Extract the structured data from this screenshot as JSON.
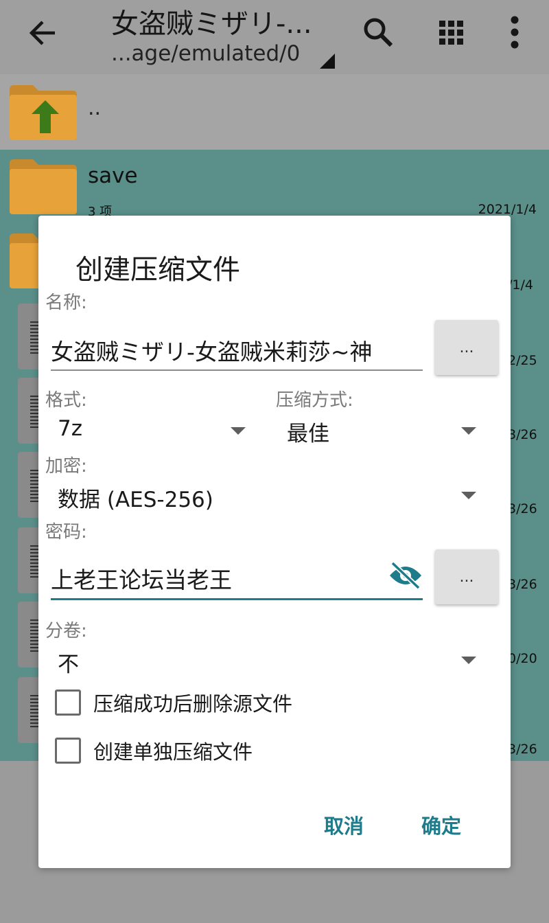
{
  "appbar": {
    "title": "女盗贼ミザリ-...",
    "subtitle": "...age/emulated/0"
  },
  "file_list": {
    "up_label": "..",
    "save_folder": {
      "name": "save",
      "count": "3 项",
      "date": "2021/1/4"
    },
    "date_fragments": [
      "/1/4",
      "2/25",
      "3/26",
      "3/26",
      "3/26",
      "0/20",
      "3/26"
    ]
  },
  "dialog": {
    "title": "创建压缩文件",
    "name_label": "名称:",
    "name_value": "女盗贼ミザリ-女盗贼米莉莎~神",
    "name_browse": "...",
    "format_label": "格式:",
    "format_value": "7z",
    "method_label": "压缩方式:",
    "method_value": "最佳",
    "encrypt_label": "加密:",
    "encrypt_value": "数据 (AES-256)",
    "password_label": "密码:",
    "password_value": "上老王论坛当老王",
    "password_browse": "...",
    "split_label": "分卷:",
    "split_value": "不",
    "delete_source_label": "压缩成功后删除源文件",
    "separate_label": "创建单独压缩文件",
    "cancel_label": "取消",
    "ok_label": "确定"
  },
  "colors": {
    "accent": "#1e7b8a",
    "folder": "#e8a23a",
    "selected_row": "#5a8f8a"
  }
}
